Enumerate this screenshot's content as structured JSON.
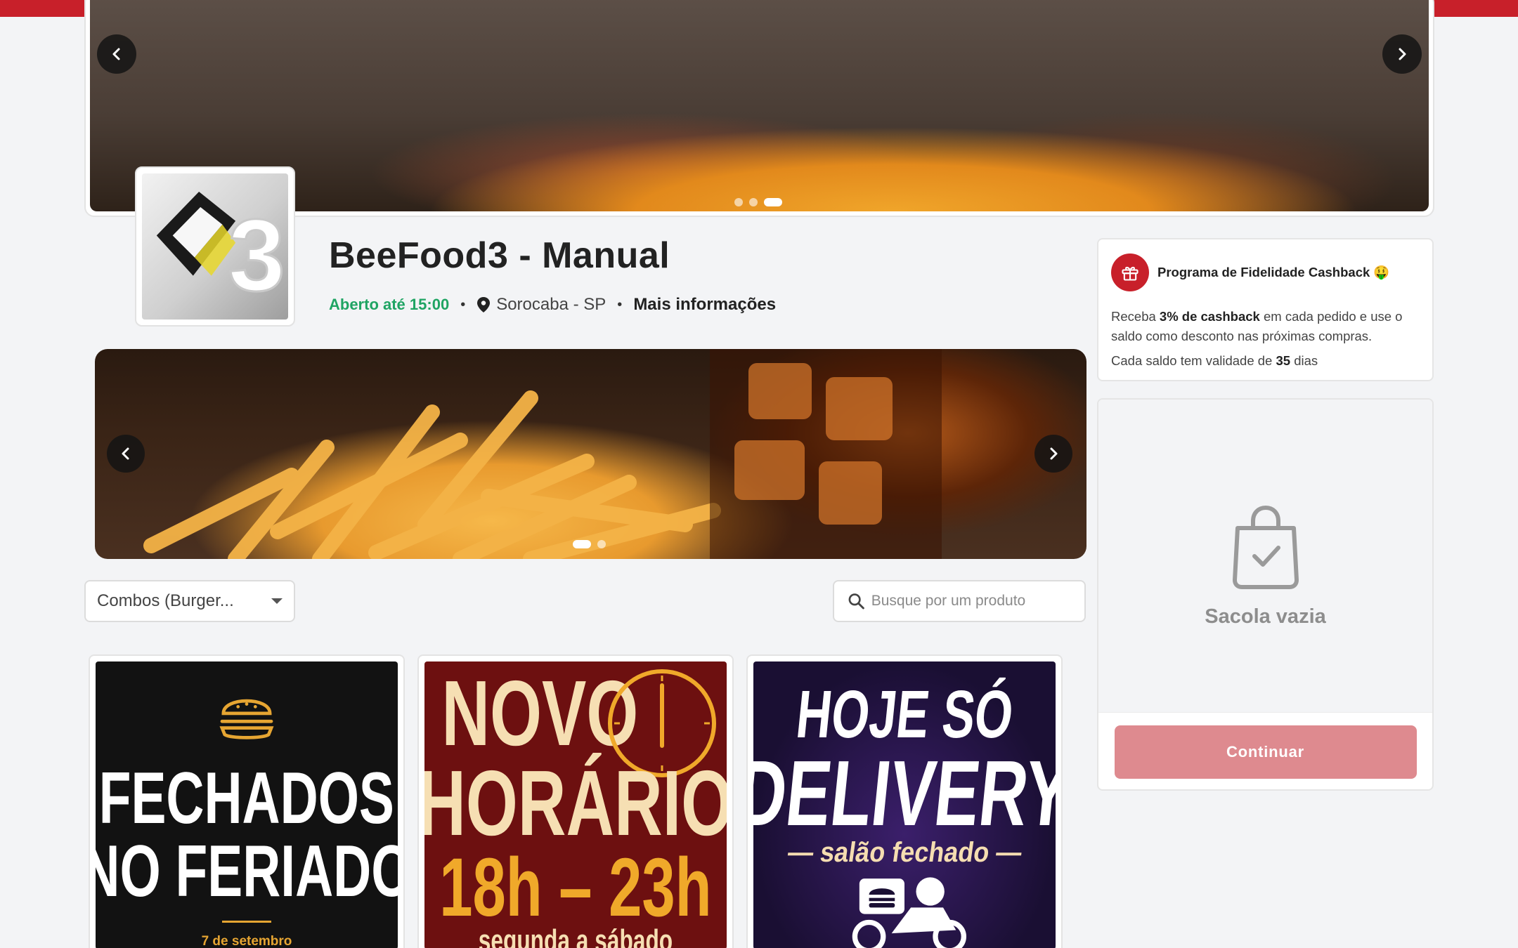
{
  "colors": {
    "brand_red": "#c8202a",
    "open_green": "#1fa463",
    "continue_disabled": "#de8a8f"
  },
  "hero": {
    "prev_icon": "chevron-left-icon",
    "next_icon": "chevron-right-icon",
    "slides": 3,
    "active_slide": 3
  },
  "store": {
    "name": "BeeFood3 - Manual",
    "status": "Aberto até 15:00",
    "location_icon": "map-pin-icon",
    "location": "Sorocaba - SP",
    "more_info": "Mais informações"
  },
  "promo_banner": {
    "slides": 2,
    "active_slide": 1
  },
  "filters": {
    "category_selected": "Combos (Burger...",
    "search_placeholder": "Busque por um produto",
    "search_icon": "search-icon"
  },
  "products": [
    {
      "lines": [
        "FECHADOS",
        "NO FERIADO"
      ],
      "caption": "7 de setembro",
      "icon": "burger-icon"
    },
    {
      "lines": [
        "NOVO",
        "HORÁRIO",
        "18h – 23h",
        "segunda a sábado"
      ],
      "icon": "clock-icon"
    },
    {
      "lines": [
        "HOJE SÓ",
        "DELIVERY",
        "— salão fechado —"
      ],
      "icon": "motorcycle-icon"
    }
  ],
  "loyalty": {
    "icon": "gift-icon",
    "title": "Programa de Fidelidade Cashback 🤑",
    "desc_prefix": "Receba ",
    "desc_bold": "3% de cashback",
    "desc_suffix": " em cada pedido e use o saldo como desconto nas próximas compras.",
    "validity_prefix": "Cada saldo tem validade de ",
    "validity_days": "35",
    "validity_suffix": " dias"
  },
  "bag": {
    "icon": "shopping-bag-icon",
    "empty_label": "Sacola vazia",
    "continue_label": "Continuar"
  }
}
